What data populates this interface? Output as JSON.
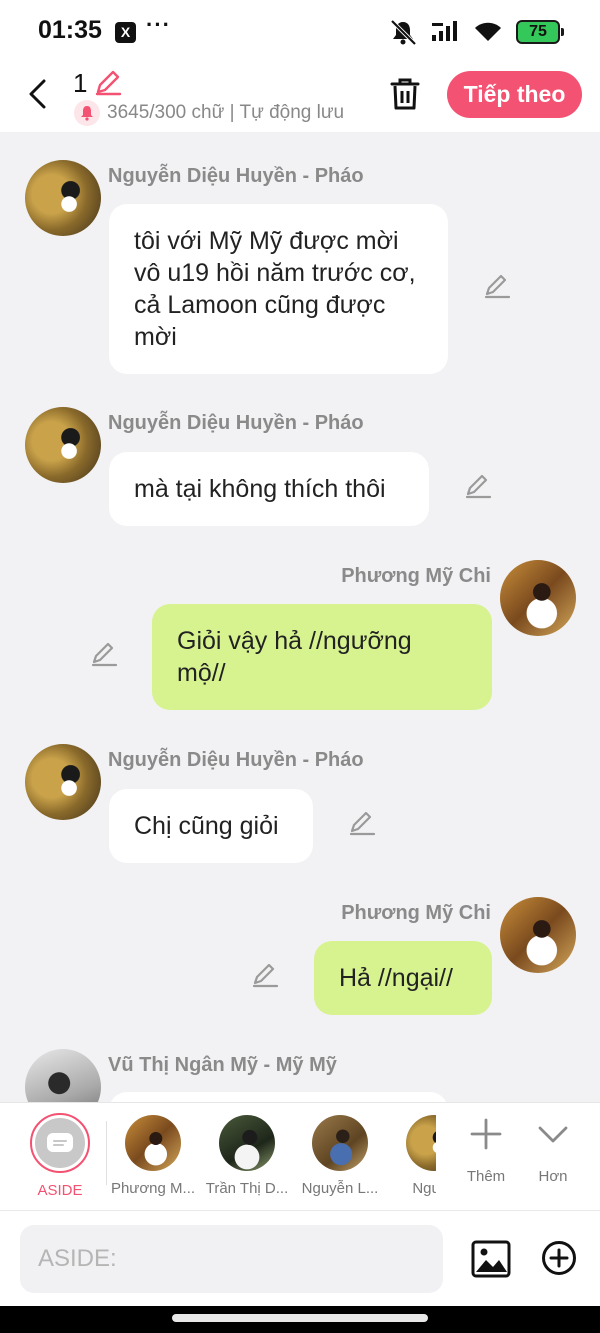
{
  "status_bar": {
    "time": "01:35",
    "x_badge": "X",
    "more": "···",
    "battery": "75"
  },
  "header": {
    "title": "1",
    "counter": "3645/300 chữ | Tự động lưu",
    "next_label": "Tiếp theo"
  },
  "messages": [
    {
      "side": "left",
      "sender": "Nguyễn Diệu Huyền - Pháo",
      "text": "tôi với Mỹ Mỹ được mời vô u19 hồi năm trước cơ, cả Lamoon cũng được mời"
    },
    {
      "side": "left",
      "sender": "Nguyễn Diệu Huyền - Pháo",
      "text": "mà tại không thích thôi"
    },
    {
      "side": "right",
      "sender": "Phương Mỹ Chi",
      "text": "Giỏi vậy hả //ngưỡng mộ//"
    },
    {
      "side": "left",
      "sender": "Nguyễn Diệu Huyền - Pháo",
      "text": "Chị cũng giỏi"
    },
    {
      "side": "right",
      "sender": "Phương Mỹ Chi",
      "text": "Hả //ngại//"
    },
    {
      "side": "left",
      "sender": "Vũ Thị Ngân Mỹ - Mỹ Mỹ",
      "text": ""
    }
  ],
  "character_bar": {
    "aside_label": "ASIDE",
    "characters": [
      "Phương M...",
      "Trần Thị D...",
      "Nguyễn L...",
      "Nguyễ"
    ],
    "more_label": "Thêm",
    "less_label": "Hơn"
  },
  "input": {
    "placeholder": "ASIDE:",
    "value": ""
  },
  "colors": {
    "accent": "#f35272",
    "bubble_self": "#d7f38f",
    "bubble_other": "#ffffff",
    "chat_background": "#f2f2f4"
  },
  "icons": [
    "back-arrow-icon",
    "pencil-icon",
    "bell-icon",
    "trash-icon",
    "plus-icon",
    "chevron-down-icon",
    "image-icon",
    "add-circle-icon",
    "mute-icon",
    "signal-icon",
    "wifi-icon",
    "battery-icon"
  ]
}
